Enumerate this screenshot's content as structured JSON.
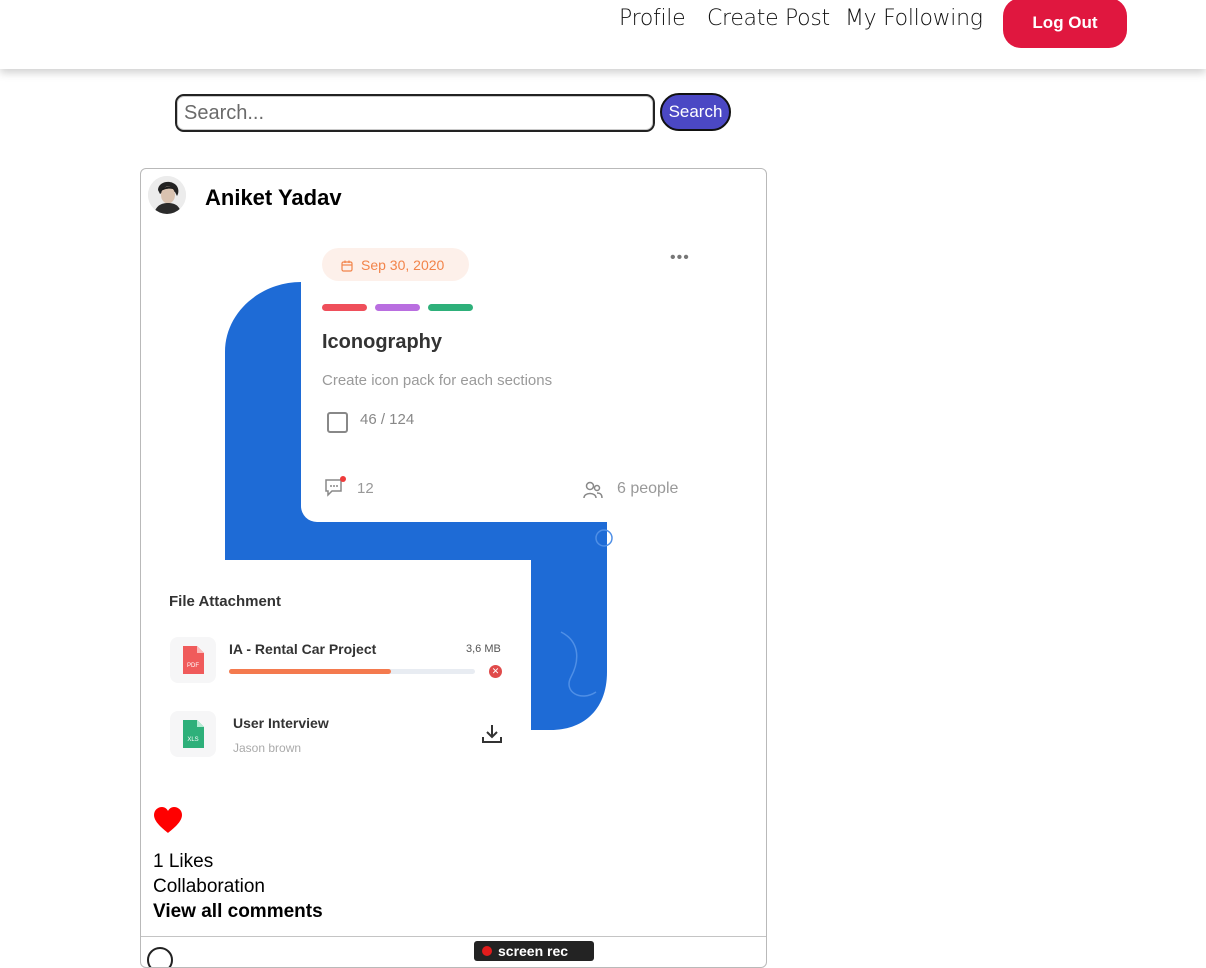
{
  "nav": {
    "profile": "Profile",
    "create_post": "Create Post",
    "my_following": "My Following",
    "logout": "Log Out"
  },
  "search": {
    "placeholder": "Search...",
    "value": "",
    "button": "Search"
  },
  "post": {
    "author": "Aniket Yadav",
    "likes_text": "1 Likes",
    "caption": "Collaboration",
    "view_comments": "View all comments",
    "image": {
      "date": "Sep 30, 2020",
      "title": "Iconography",
      "subtitle": "Create icon pack for each sections",
      "tasks": "46 / 124",
      "comments_count": "12",
      "people": "6 people",
      "file_section_title": "File Attachment",
      "file1_name": "IA - Rental Car Project",
      "file1_size": "3,6 MB",
      "file1_badge": "PDF",
      "file1_progress": 0.66,
      "file2_name": "User Interview",
      "file2_owner": "Jason brown",
      "file2_badge": "XLS"
    }
  },
  "overlay": {
    "recorder_label": "screen rec"
  },
  "colors": {
    "logout": "#e0173f",
    "search_button": "#4b48c4",
    "heart": "#ff0000",
    "blue_shape": "#1e6bd6",
    "date_pill_text": "#f2844a"
  }
}
